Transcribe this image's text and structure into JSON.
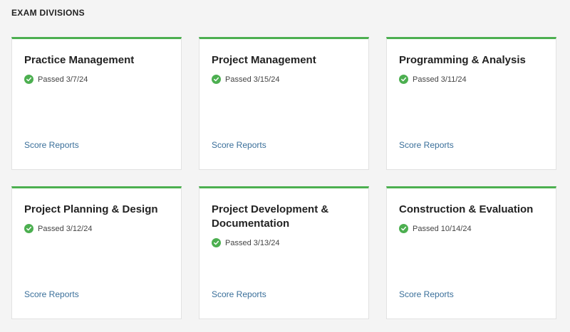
{
  "section": {
    "title": "EXAM DIVISIONS"
  },
  "cards": [
    {
      "title": "Practice Management",
      "status": "Passed 3/7/24",
      "link": "Score Reports"
    },
    {
      "title": "Project Management",
      "status": "Passed 3/15/24",
      "link": "Score Reports"
    },
    {
      "title": "Programming & Analysis",
      "status": "Passed 3/11/24",
      "link": "Score Reports"
    },
    {
      "title": "Project Planning & Design",
      "status": "Passed 3/12/24",
      "link": "Score Reports"
    },
    {
      "title": "Project Development & Documentation",
      "status": "Passed 3/13/24",
      "link": "Score Reports"
    },
    {
      "title": "Construction & Evaluation",
      "status": "Passed 10/14/24",
      "link": "Score Reports"
    }
  ],
  "colors": {
    "accent": "#4caf50",
    "link": "#3a6f9a",
    "background": "#f4f4f4"
  },
  "icons": {
    "status": "check-circle-icon"
  }
}
